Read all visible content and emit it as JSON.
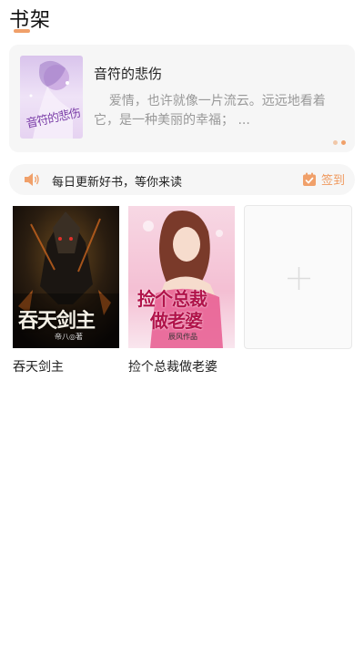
{
  "header": {
    "title": "书架"
  },
  "recommend": {
    "title": "音符的悲伤",
    "description": "爱情，也许就像一片流云。远远地看着它，是一种美丽的幸福； ...",
    "cover_text": "音符的悲伤",
    "pager": {
      "count": 2,
      "active": 2
    }
  },
  "notice": {
    "icon": "speaker-icon",
    "text": "每日更新好书，等你来读",
    "signin_icon": "calendar-check-icon",
    "signin_label": "签到"
  },
  "shelf": {
    "books": [
      {
        "title": "吞天剑主",
        "cover_title": "吞天剑主",
        "cover_author": "帝八◎著"
      },
      {
        "title": "捡个总裁做老婆",
        "cover_title_line1": "捡个总裁",
        "cover_title_line2": "做老婆",
        "cover_author": "辰风作品"
      }
    ],
    "add_icon": "plus-icon"
  },
  "colors": {
    "accent": "#f0a06a",
    "card_bg": "#f6f6f6"
  }
}
